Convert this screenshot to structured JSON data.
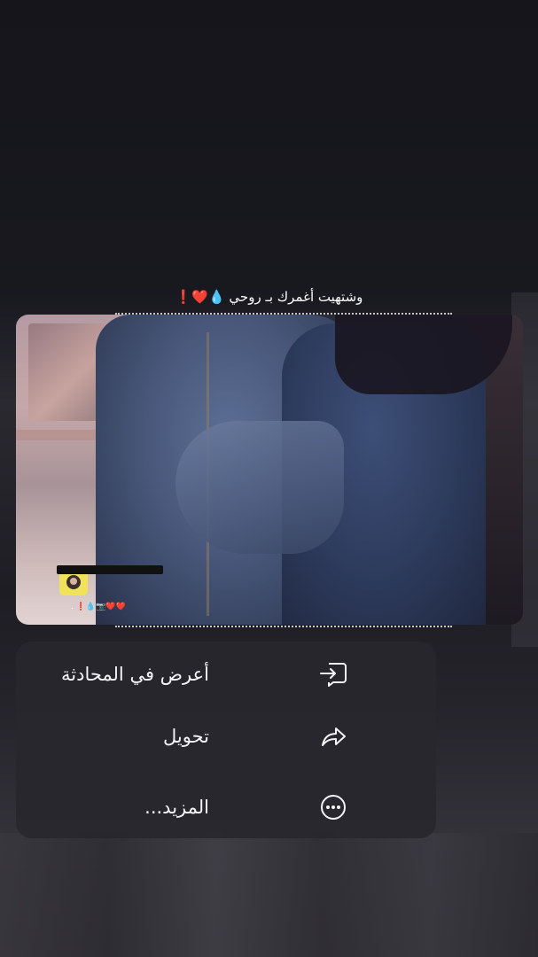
{
  "post": {
    "caption_text": "وشتهيت أغمرك بـ روحي",
    "caption_emoji": "💧❤️❗",
    "watermark_text": "❤️❤️📷💧❗ ."
  },
  "menu": {
    "items": [
      {
        "label": "أعرض في المحادثة",
        "icon": "open-in-chat-icon"
      },
      {
        "label": "تحويل",
        "icon": "forward-icon"
      },
      {
        "label": "المزيد...",
        "icon": "more-icon"
      }
    ]
  },
  "colors": {
    "menu_background": "#28272e",
    "text": "#f4f4f6",
    "heart": "#e0303c",
    "drop": "#4aa3ff",
    "exclamation": "#f2c230"
  }
}
